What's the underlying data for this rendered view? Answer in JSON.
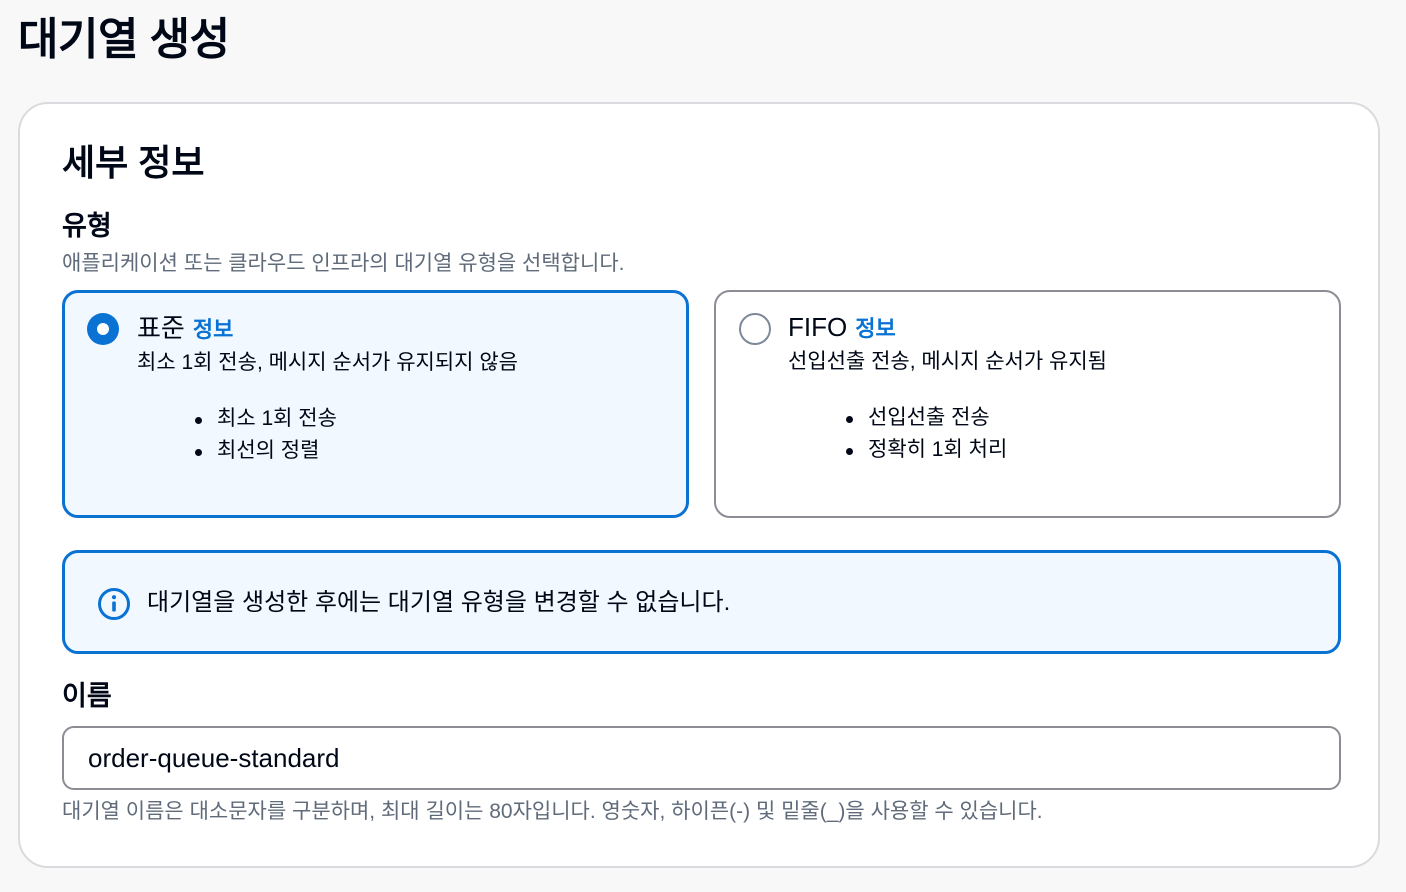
{
  "page": {
    "title": "대기열 생성"
  },
  "details": {
    "title": "세부 정보",
    "type_field": {
      "label": "유형",
      "description": "애플리케이션 또는 클라우드 인프라의 대기열 유형을 선택합니다.",
      "selected": "표준",
      "options": [
        {
          "title": "표준",
          "info_link": "정보",
          "description": "최소 1회 전송, 메시지 순서가 유지되지 않음",
          "bullets": [
            "최소 1회 전송",
            "최선의 정렬"
          ]
        },
        {
          "title": "FIFO",
          "info_link": "정보",
          "description": "선입선출 전송, 메시지 순서가 유지됨",
          "bullets": [
            "선입선출 전송",
            "정확히 1회 처리"
          ]
        }
      ]
    },
    "alert": {
      "icon": "info-icon",
      "text": "대기열을 생성한 후에는 대기열 유형을 변경할 수 없습니다."
    },
    "name_field": {
      "label": "이름",
      "value": "order-queue-standard",
      "constraint": "대기열 이름은 대소문자를 구분하며, 최대 길이는 80자입니다. 영숫자, 하이픈(-) 및 밑줄(_)을 사용할 수 있습니다."
    }
  },
  "colors": {
    "accent": "#0972d3",
    "selected_bg": "#f1f8ff",
    "text": "#000716",
    "muted_text": "#5f6b7a",
    "border": "#8c8c94"
  }
}
